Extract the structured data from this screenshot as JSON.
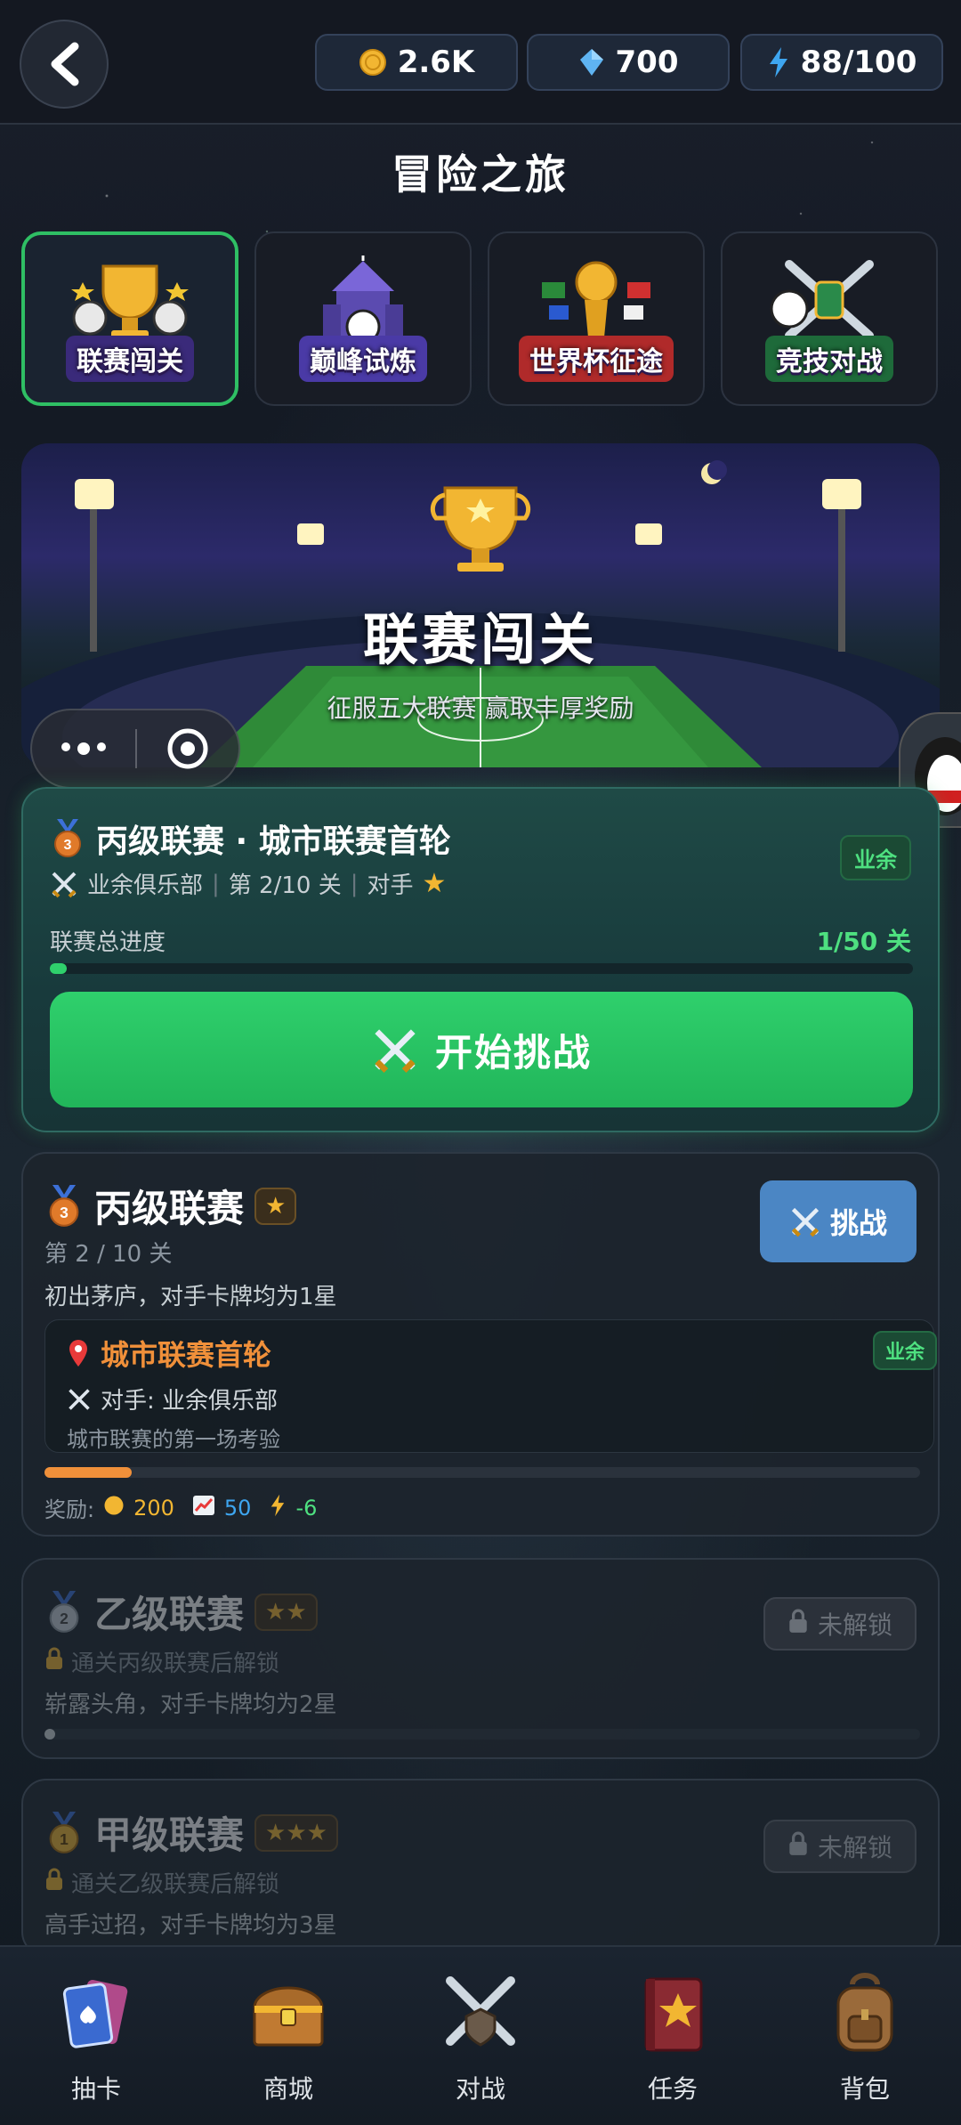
{
  "header": {
    "coins": "2.6K",
    "gems": "700",
    "energy": "88/100"
  },
  "page_title": "冒险之旅",
  "mode_tabs": [
    {
      "label": "联赛闯关",
      "active": true
    },
    {
      "label": "巅峰试炼",
      "active": false
    },
    {
      "label": "世界杯征途",
      "active": false
    },
    {
      "label": "竞技对战",
      "active": false
    }
  ],
  "banner": {
    "title": "联赛闯关",
    "subtitle": "征服五大联赛 赢取丰厚奖励"
  },
  "current": {
    "medal": "3",
    "title": "丙级联赛 · 城市联赛首轮",
    "opponent_club": "业余俱乐部",
    "stage": "第 2/10 关",
    "opponent_label": "对手",
    "badge": "业余",
    "progress_label": "联赛总进度",
    "progress_value": "1/50 关",
    "progress_fraction": 0.02,
    "start_label": "开始挑战"
  },
  "leagues": [
    {
      "medal": "3",
      "name": "丙级联赛",
      "stars": "★",
      "stage": "第 2 / 10 关",
      "desc": "初出茅庐，对手卡牌均为1星",
      "button": "挑战",
      "stage_detail": {
        "title": "城市联赛首轮",
        "badge": "业余",
        "opponent": "对手: 业余俱乐部",
        "desc": "城市联赛的第一场考验"
      },
      "progress_fraction": 0.1,
      "rewards_label": "奖励:",
      "reward_coins": "200",
      "reward_exp": "50",
      "reward_energy": "-6"
    },
    {
      "medal": "2",
      "name": "乙级联赛",
      "stars": "★★",
      "lock_text": "通关丙级联赛后解锁",
      "desc": "崭露头角，对手卡牌均为2星",
      "button": "未解锁",
      "progress_fraction": 0.01
    },
    {
      "medal": "1",
      "name": "甲级联赛",
      "stars": "★★★",
      "lock_text": "通关乙级联赛后解锁",
      "desc": "高手过招，对手卡牌均为3星",
      "button": "未解锁"
    }
  ],
  "bottom_nav": [
    {
      "label": "抽卡",
      "icon": "cards-icon"
    },
    {
      "label": "商城",
      "icon": "chest-icon"
    },
    {
      "label": "对战",
      "icon": "crossed-swords-icon"
    },
    {
      "label": "任务",
      "icon": "quest-book-icon"
    },
    {
      "label": "背包",
      "icon": "backpack-icon"
    }
  ],
  "colors": {
    "accent_green": "#2fbf64",
    "gold": "#f2b632",
    "challenge_blue": "#4b86c4",
    "stage_orange": "#f0903a"
  }
}
